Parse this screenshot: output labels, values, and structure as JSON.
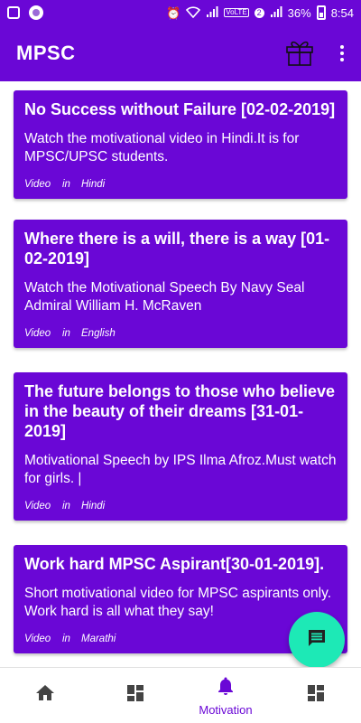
{
  "status_bar": {
    "battery": "36%",
    "time": "8:54",
    "notification_count": "2",
    "network": "VoLTE"
  },
  "app_bar": {
    "title": "MPSC"
  },
  "cards": [
    {
      "title": "No Success without Failure [02-02-2019]",
      "description": "Watch the motivational video in Hindi.It is for MPSC/UPSC students.",
      "type": "Video",
      "in": "in",
      "language": "Hindi"
    },
    {
      "title": " Where there is a will, there is a way [01-02-2019]",
      "description": "Watch the Motivational Speech By Navy Seal Admiral William H. McRaven",
      "type": "Video",
      "in": "in",
      "language": "English"
    },
    {
      "title": "The future belongs to those who believe in the beauty of their dreams [31-01-2019]",
      "description": "Motivational Speech by IPS Ilma Afroz.Must watch for girls. |",
      "type": "Video",
      "in": "in",
      "language": "Hindi"
    },
    {
      "title": "Work hard MPSC Aspirant[30-01-2019].",
      "description": "Short motivational video for MPSC aspirants only. Work hard is all what they say!",
      "type": "Video",
      "in": "in",
      "language": "Marathi"
    }
  ],
  "bottom_nav": {
    "items": [
      {
        "icon": "home-icon",
        "label": ""
      },
      {
        "icon": "dashboard-icon",
        "label": ""
      },
      {
        "icon": "bell-icon",
        "label": "Motivation"
      },
      {
        "icon": "dashboard-icon",
        "label": ""
      }
    ]
  },
  "colors": {
    "primary": "#6a07d6",
    "accent": "#1de9b6",
    "nav_icon": "#444444"
  }
}
